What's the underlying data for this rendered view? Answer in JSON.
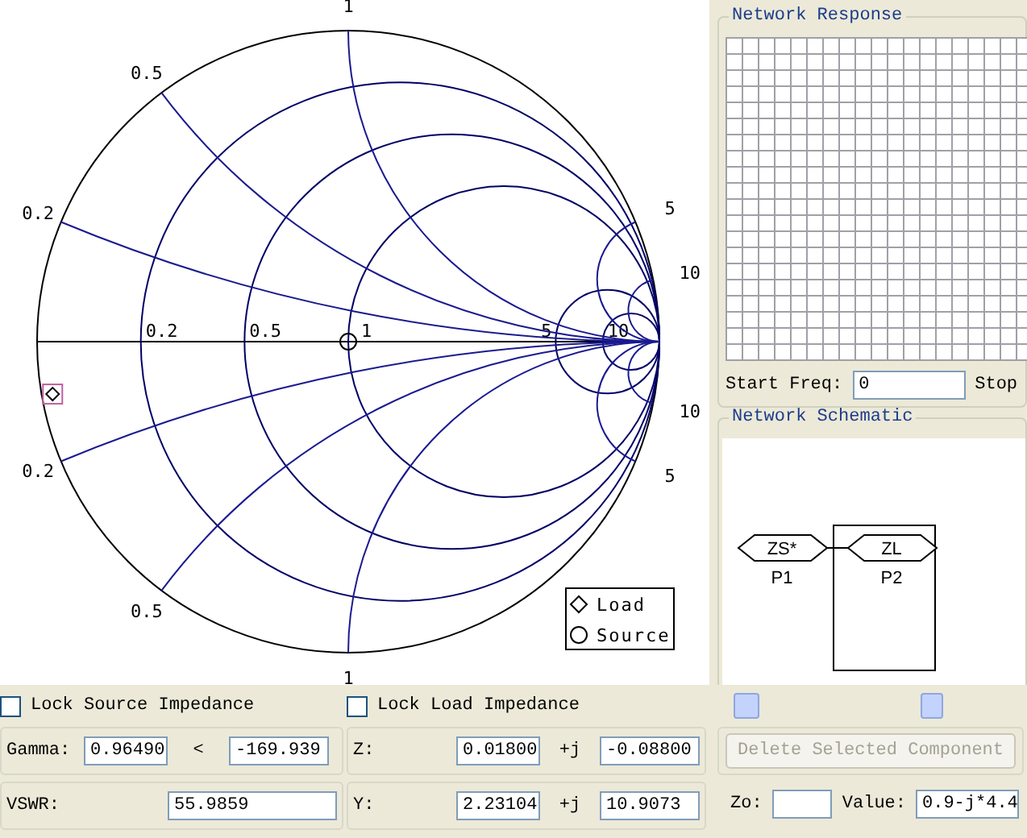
{
  "smith_chart": {
    "resistance_circles": [
      {
        "label": "0.2"
      },
      {
        "label": "0.5"
      },
      {
        "label": "1"
      },
      {
        "label": "5"
      },
      {
        "label": "10"
      }
    ],
    "upper_reactance_arcs": [
      {
        "label": "0.2"
      },
      {
        "label": "0.5"
      },
      {
        "label": "1"
      },
      {
        "label": "5"
      },
      {
        "label": "10"
      }
    ],
    "lower_reactance_arcs": [
      {
        "label": "0.2"
      },
      {
        "label": "0.5"
      },
      {
        "label": "1"
      },
      {
        "label": "5"
      },
      {
        "label": "10"
      }
    ],
    "legend": [
      {
        "kind": "load",
        "label": "Load"
      },
      {
        "kind": "source",
        "label": "Source"
      }
    ]
  },
  "network_response": {
    "title": "Network Response",
    "start_freq_label": "Start Freq:",
    "start_freq": "0",
    "stop_freq_label": "Stop"
  },
  "network_schematic": {
    "title": "Network Schematic",
    "ports": [
      {
        "name": "ZS*",
        "port": "P1"
      },
      {
        "name": "ZL",
        "port": "P2"
      }
    ]
  },
  "source": {
    "lock_label": "Lock Source Impedance",
    "locked": false,
    "gamma_label": "Gamma:",
    "gamma_mag": "0.96490",
    "angle_sign": "<",
    "gamma_angle": "-169.939",
    "vswr_label": "VSWR:",
    "vswr": "55.9859"
  },
  "load": {
    "lock_label": "Lock Load Impedance",
    "locked": false,
    "z_label": "Z:",
    "z_real": "0.01800",
    "z_j": "+j",
    "z_imag": "-0.08800",
    "y_label": "Y:",
    "y_real": "2.23104",
    "y_j": "+j",
    "y_imag": "10.9073"
  },
  "component": {
    "delete_button": "Delete Selected Component",
    "delete_disabled": true,
    "zo_label": "Zo:",
    "value_label": "Value:",
    "value": "0.9-j*4.4"
  }
}
